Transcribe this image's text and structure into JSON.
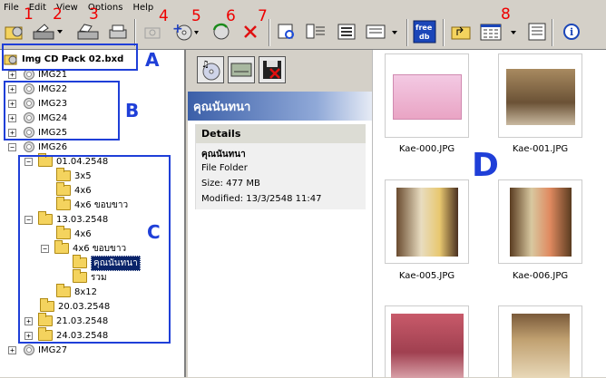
{
  "menu": [
    "File",
    "Edit",
    "View",
    "Options",
    "Help"
  ],
  "callouts": {
    "n1": "1",
    "n2": "2",
    "n3": "3",
    "n4": "4",
    "n5": "5",
    "n6": "6",
    "n7": "7",
    "n8": "8",
    "a": "A",
    "b": "B",
    "c": "C",
    "d": "D"
  },
  "tree": {
    "root": "Img CD Pack 02.bxd",
    "items": [
      {
        "label": "IMG21"
      },
      {
        "label": "IMG22"
      },
      {
        "label": "IMG23"
      },
      {
        "label": "IMG24"
      },
      {
        "label": "IMG25"
      },
      {
        "label": "IMG26"
      },
      {
        "label": "01.04.2548"
      },
      {
        "label": "3x5"
      },
      {
        "label": "4x6"
      },
      {
        "label": "4x6 ขอบขาว"
      },
      {
        "label": "13.03.2548"
      },
      {
        "label": "4x6"
      },
      {
        "label": "4x6 ขอบขาว"
      },
      {
        "label": "คุณนันทนา"
      },
      {
        "label": "รวม"
      },
      {
        "label": "8x12"
      },
      {
        "label": "20.03.2548"
      },
      {
        "label": "21.03.2548"
      },
      {
        "label": "24.03.2548"
      },
      {
        "label": "IMG27"
      }
    ]
  },
  "panel": {
    "title": "คุณนันทนา",
    "details_header": "Details",
    "name": "คุณนันทนา",
    "type": "File Folder",
    "size": "Size: 477 MB",
    "modified": "Modified: 13/3/2548 11:47"
  },
  "thumbs": [
    {
      "name": "Kae-000.JPG"
    },
    {
      "name": "Kae-001.JPG"
    },
    {
      "name": "Kae-005.JPG"
    },
    {
      "name": "Kae-006.JPG"
    }
  ],
  "colors": {
    "callout_red": "#e00000",
    "callout_blue": "#1f3fd8",
    "accent": "#3b5fa8"
  }
}
